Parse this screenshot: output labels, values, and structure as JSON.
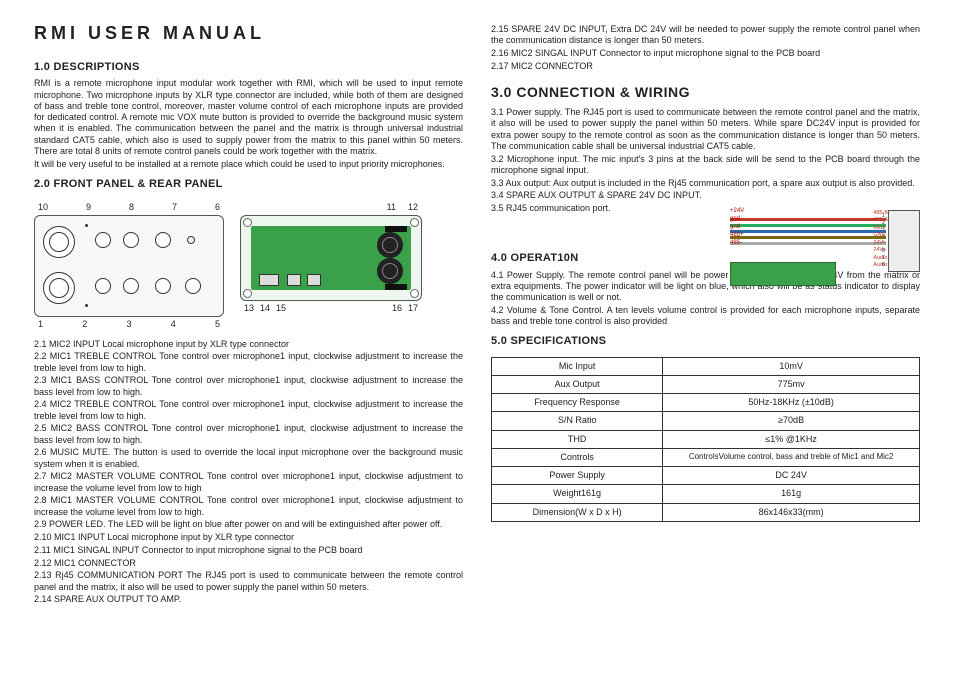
{
  "title": "RMI  USER  MANUAL",
  "s1": {
    "heading": "1.0 DESCRIPTIONS",
    "p1": "RMI is a remote microphone input modular work together with RMI, which will be used to input remote microphone. Two microphone inputs by XLR type connector are included, while both of them are designed of bass and treble tone control, moreover, master volume control of each microphone inputs are provided for dedicated control. A remote mic VOX mute button is provided to override the background music system when it is enabled. The communication between the panel and the matrix is through universal industrial standard CAT5 cable, which also is used to supply power from the matrix to this panel within 50 meters. There are total 8 units of remote control panels could be work together with the matrix.",
    "p2": "It will be very useful to be installed at a remote place which could be used to input priority microphones."
  },
  "s2": {
    "heading": "2.0 FRONT PANEL & REAR PANEL",
    "front_top": [
      "10",
      "9",
      "8",
      "7",
      "6"
    ],
    "front_bottom": [
      "1",
      "2",
      "3",
      "4",
      "5"
    ],
    "rear_top": [
      "11",
      "12"
    ],
    "rear_bottom": [
      "13",
      "14",
      "15",
      "16",
      "17"
    ],
    "items": [
      "2.1  MIC2 INPUT  Local microphone input by XLR type connector",
      "2.2  MIC1 TREBLE CONTROL Tone control over microphone1 input, clockwise adjustment to increase the treble level from low to high.",
      "2.3 MIC1 BASS CONTROL Tone control over microphone1 input, clockwise adjustment to increase the bass level from low to high.",
      "2.4 MIC2 TREBLE CONTROL Tone control over microphone1 input, clockwise adjustment to increase the treble level from low to high.",
      "2.5 MIC2 BASS CONTROL Tone control over microphone1 input, clockwise adjustment to increase the bass level from low to high.",
      "2.6  MUSIC MUTE. The button is used to override the local input microphone over the background music system when it is enabled.",
      "2.7 MIC2 MASTER VOLUME CONTROL Tone control over microphone1 input, clockwise adjustment to increase the volume level from low to high",
      "2.8 MIC1 MASTER VOLUME CONTROL Tone control over microphone1 input, clockwise adjustment to increase the volume level from low to high.",
      "2.9  POWER LED. The LED will be light on blue after power on and will be extinguished after power off.",
      "2.10 MIC1 INPUT Local microphone input by XLR type connector",
      "2.11 MIC1 SINGAL INPUT Connector to input microphone signal to the PCB board",
      "2.12 MIC1 CONNECTOR",
      "2.13 Rj45 COMMUNICATION PORT The RJ45 port is used to communicate between the remote control panel and the matrix, it also will be used to power supply the panel within 50 meters.",
      "2.14 SPARE AUX OUTPUT TO AMP."
    ]
  },
  "s2b": {
    "items": [
      "2.15 SPARE 24V DC INPUT, Extra DC 24V will be needed to power supply the remote control panel when the communication distance is longer than 50 meters.",
      "2.16 MIC2 SINGAL INPUT Connector to input microphone signal to the PCB board",
      "2.17 MIC2 CONNECTOR"
    ]
  },
  "s3": {
    "heading": "3.0 CONNECTION & WIRING",
    "items": [
      "3.1  Power supply. The RJ45 port is used to communicate between the remote control panel and the matrix, it also will be used to power supply the panel within 50 meters. While spare DC24V input is provided for extra power soupy to the remote control as soon as the communication distance is longer than 50 meters. The communication cable shall be universal industrial CAT5 cable.",
      "3.2  Microphone input. The mic input's 3 pins at the back side will be send to the PCB board through the microphone signal input.",
      "3.3  Aux output: Aux output is included in the Rj45 communication port, a spare aux output is also provided.",
      "3.4  SPARE AUX OUTPUT & SPARE 24V DC INPUT.",
      "3.5  RJ45 communication port."
    ],
    "wiring_labels": [
      "+24V",
      "gnd",
      "gnd",
      "485+",
      "485-"
    ],
    "rj_labels": [
      "485-B",
      "485-A",
      "RED",
      "GND",
      "24V+",
      "24V+",
      "Audio",
      "Audio"
    ]
  },
  "s4": {
    "heading": "4.0  OPERAT10N",
    "items": [
      "4.1 Power Supply. The remote control panel will be power on whether there is DC24V from the matrix or extra equipments. The power indicator will be light on blue, which also will be as status indicator to display the communication is well or not.",
      "4.2 Volume & Tone Control. A ten levels volume control is provided for each microphone inputs, separate bass and treble tone control is also provided"
    ]
  },
  "s5": {
    "heading": "5.0 SPECIFICATIONS",
    "rows": [
      [
        "Mic Input",
        "10mV"
      ],
      [
        "Aux Output",
        "775mv"
      ],
      [
        "Frequency Response",
        "50Hz-18KHz (±10dB)"
      ],
      [
        "S/N Ratio",
        "≥70dB"
      ],
      [
        "THD",
        "≤1% @1KHz"
      ],
      [
        "Controls",
        "ControlsVolume control, bass and treble of Mic1 and Mic2"
      ],
      [
        "Power Supply",
        "DC 24V"
      ],
      [
        "Weight161g",
        "161g"
      ],
      [
        "Dimension(W x D x H)",
        "86x146x33(mm)"
      ]
    ]
  }
}
